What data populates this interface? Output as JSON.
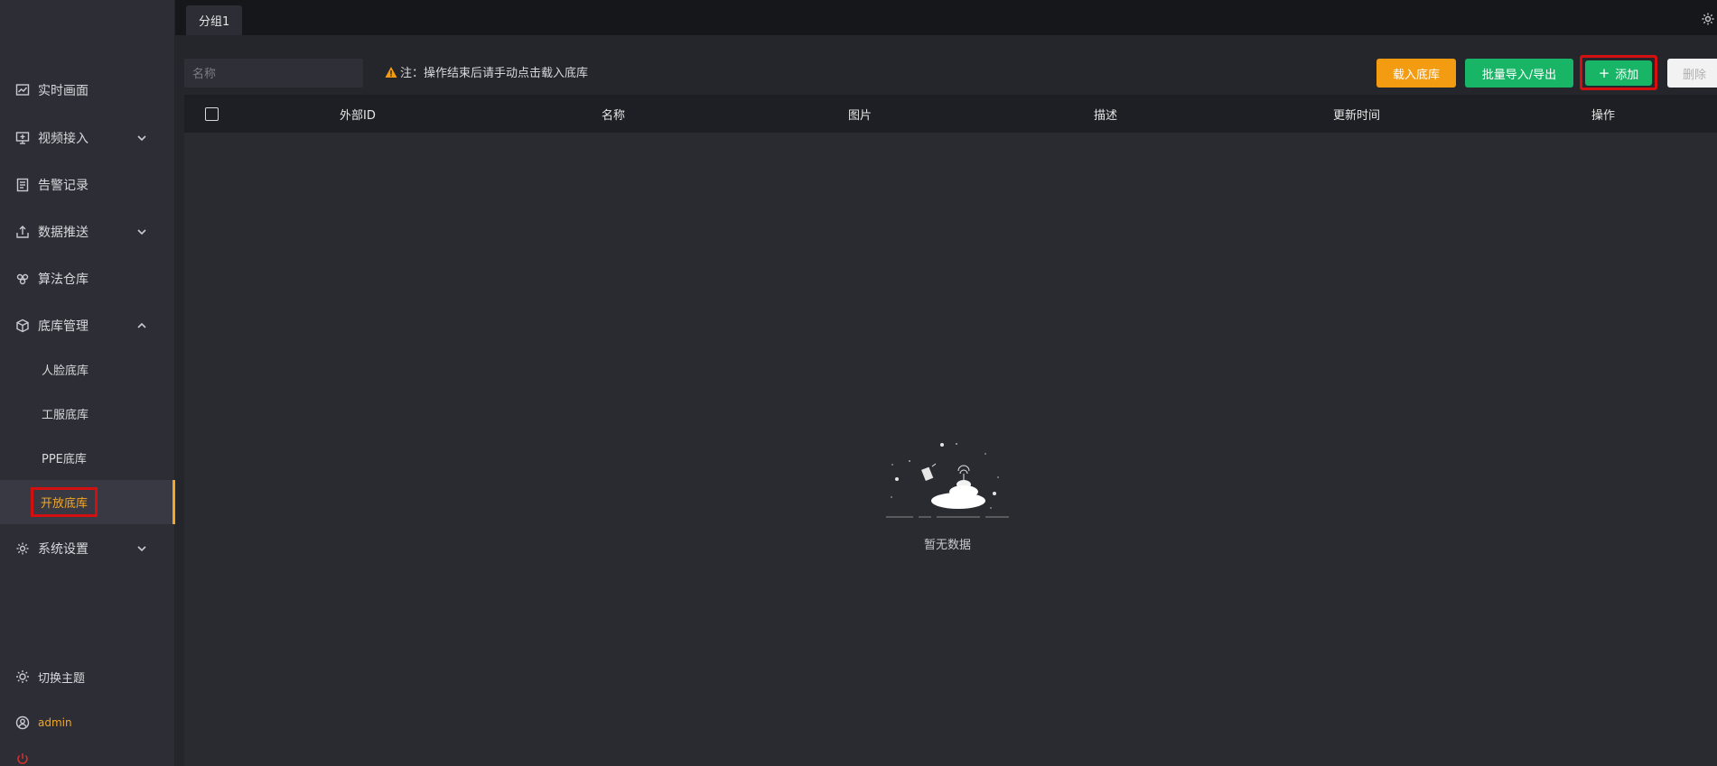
{
  "sidebar": {
    "items": [
      {
        "label": "实时画面",
        "icon": "chart-line-icon"
      },
      {
        "label": "视频接入",
        "icon": "monitor-icon",
        "expandable": true
      },
      {
        "label": "告警记录",
        "icon": "document-icon"
      },
      {
        "label": "数据推送",
        "icon": "upload-icon",
        "expandable": true
      },
      {
        "label": "算法仓库",
        "icon": "cubes-icon"
      },
      {
        "label": "底库管理",
        "icon": "box-icon",
        "expanded": true
      },
      {
        "label": "系统设置",
        "icon": "gear-icon",
        "expandable": true
      }
    ],
    "sub_items": [
      {
        "label": "人脸底库"
      },
      {
        "label": "工服底库"
      },
      {
        "label": "PPE底库"
      },
      {
        "label": "开放底库",
        "active": true
      }
    ],
    "theme_label": "切换主题",
    "user": "admin"
  },
  "tabs": [
    {
      "label": "分组1"
    }
  ],
  "toolbar": {
    "search_placeholder": "名称",
    "note": "注：操作结束后请手动点击载入底库",
    "load_label": "载入底库",
    "batch_label": "批量导入/导出",
    "add_label": "添加",
    "delete_label": "删除"
  },
  "table": {
    "columns": [
      "外部ID",
      "名称",
      "图片",
      "描述",
      "更新时间",
      "操作"
    ],
    "rows": [],
    "empty_text": "暂无数据"
  },
  "colors": {
    "accent": "#f5a623",
    "load_button": "#f39c12",
    "green_button": "#18b566",
    "highlight_border": "#d40f0f"
  }
}
